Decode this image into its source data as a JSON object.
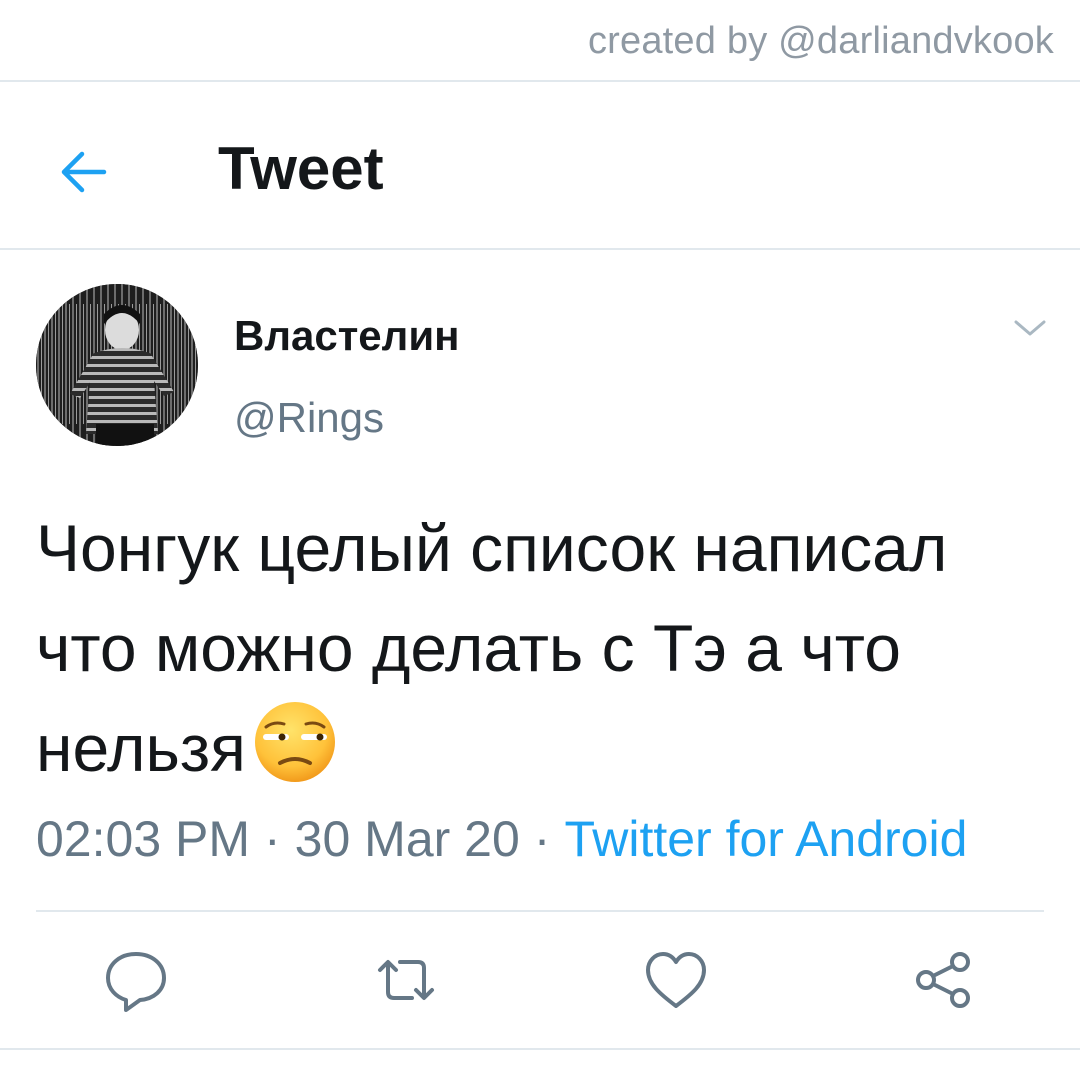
{
  "watermark": {
    "text": "created by @darliandvkook"
  },
  "header": {
    "title": "Tweet",
    "back_icon": "arrow-left-icon",
    "accent": "#1da1f2"
  },
  "author": {
    "display_name": "Властелин",
    "handle": "@Rings",
    "menu_icon": "chevron-down-icon"
  },
  "tweet": {
    "text": "Чонгук целый список написал что можно делать с Тэ а что нельзя",
    "emoji": "unamused-face-emoji"
  },
  "meta": {
    "time": "02:03 PM",
    "separator": "·",
    "date": "30 Mar 20",
    "source": "Twitter for Android"
  },
  "actions": {
    "reply_icon": "reply-icon",
    "retweet_icon": "retweet-icon",
    "like_icon": "heart-icon",
    "share_icon": "share-icon",
    "icon_color": "#657786"
  }
}
